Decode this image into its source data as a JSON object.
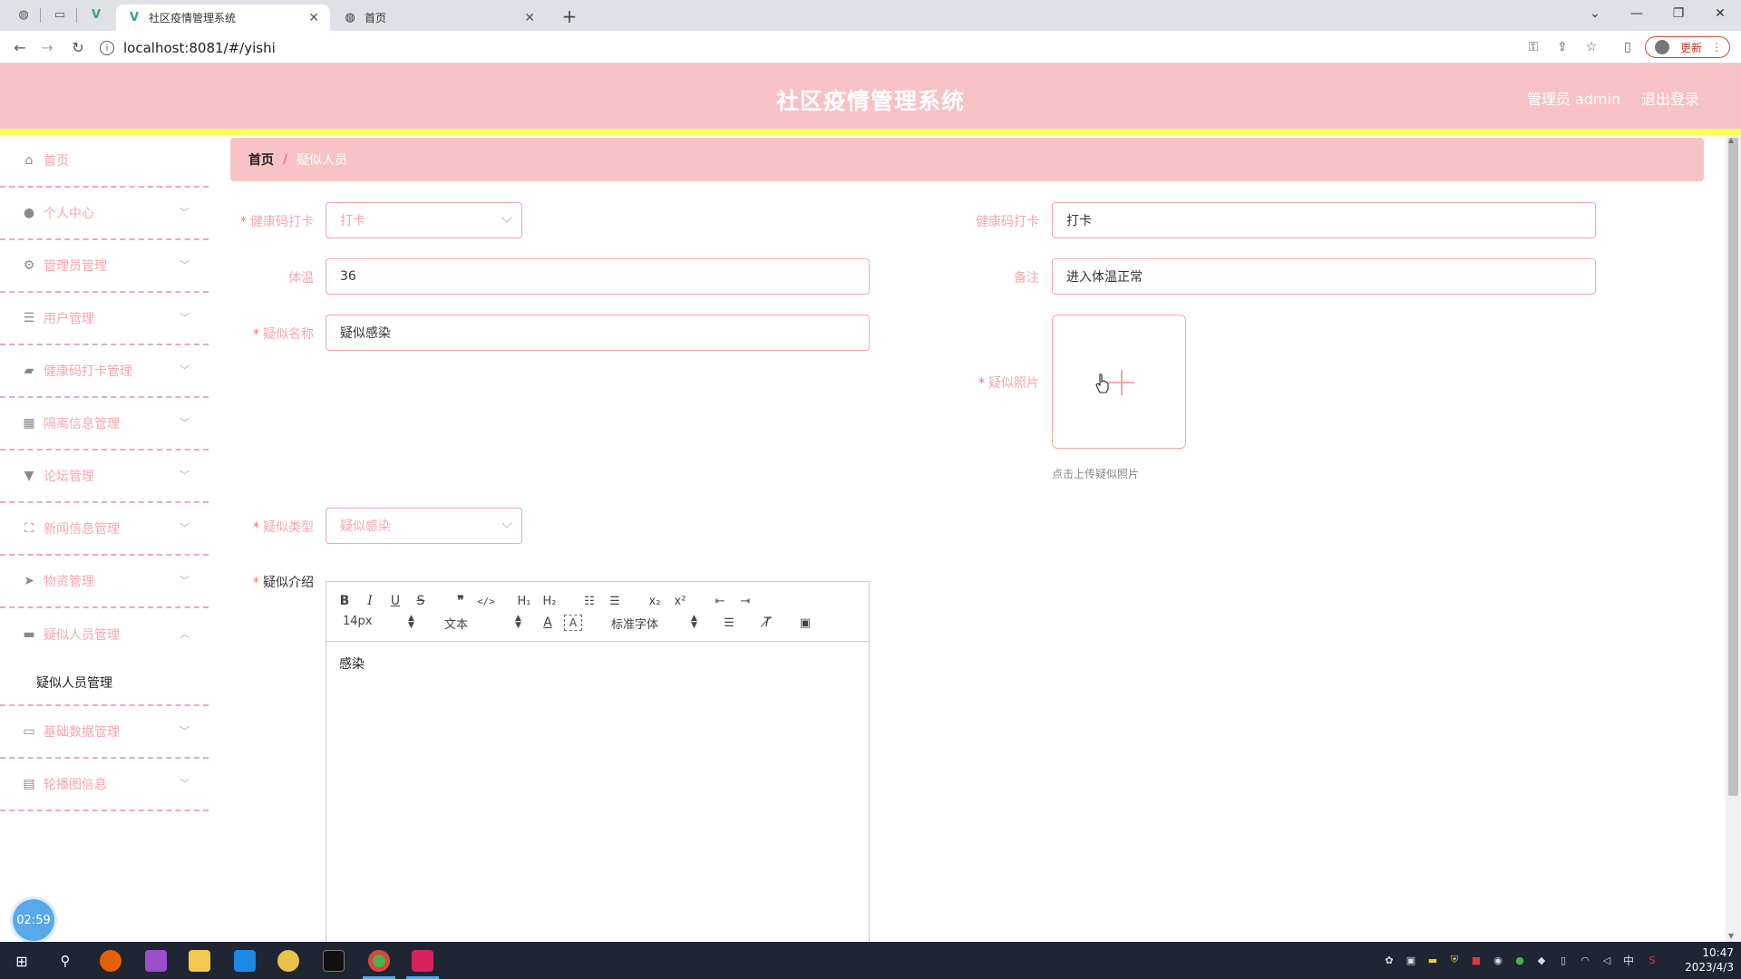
{
  "browser": {
    "tabs": [
      {
        "title": "社区疫情管理系统",
        "active": true
      },
      {
        "title": "首页",
        "active": false
      }
    ],
    "url": "localhost:8081/#/yishi",
    "update_label": "更新"
  },
  "header": {
    "title": "社区疫情管理系统",
    "user": "管理员 admin",
    "logout": "退出登录"
  },
  "sidebar": {
    "items": [
      {
        "label": "首页",
        "icon": "home-icon",
        "arrow": ""
      },
      {
        "label": "个人中心",
        "icon": "user-icon",
        "arrow": "﹀"
      },
      {
        "label": "管理员管理",
        "icon": "settings-icon",
        "arrow": "﹀"
      },
      {
        "label": "用户管理",
        "icon": "sliders-icon",
        "arrow": "﹀"
      },
      {
        "label": "健康码打卡管理",
        "icon": "briefcase-icon",
        "arrow": "﹀"
      },
      {
        "label": "隔离信息管理",
        "icon": "grid-icon",
        "arrow": "﹀"
      },
      {
        "label": "论坛管理",
        "icon": "forum-icon",
        "arrow": "﹀"
      },
      {
        "label": "新闻信息管理",
        "icon": "fullscreen-icon",
        "arrow": "﹀"
      },
      {
        "label": "物资管理",
        "icon": "send-icon",
        "arrow": "﹀"
      },
      {
        "label": "疑似人员管理",
        "icon": "ticket-icon",
        "arrow": "︿"
      },
      {
        "label": "基础数据管理",
        "icon": "monitor-icon",
        "arrow": "﹀"
      },
      {
        "label": "轮播图信息",
        "icon": "clipboard-icon",
        "arrow": "﹀"
      }
    ],
    "sub_item": "疑似人员管理",
    "timer": "02:59"
  },
  "breadcrumb": {
    "home": "首页",
    "sep": "/",
    "current": "疑似人员"
  },
  "form": {
    "health_select_label": "健康码打卡",
    "health_select_value": "打卡",
    "health_text_label": "健康码打卡",
    "health_text_value": "打卡",
    "temp_label": "体温",
    "temp_value": "36",
    "remark_label": "备注",
    "remark_value": "进入体温正常",
    "name_label": "疑似名称",
    "name_value": "疑似感染",
    "photo_label": "疑似照片",
    "photo_hint": "点击上传疑似照片",
    "type_label": "疑似类型",
    "type_value": "疑似感染",
    "intro_label": "疑似介绍",
    "intro_content": "感染"
  },
  "editor": {
    "font_size": "14px",
    "block_format": "文本",
    "font_family": "标准字体"
  },
  "taskbar": {
    "time": "10:47",
    "date": "2023/4/3",
    "ime": "中"
  },
  "colors": {
    "header_bg": "#f7c2c4",
    "accent_text": "#f3a6ae",
    "yellow_bar": "#ffff55",
    "required": "#f56c6c"
  }
}
